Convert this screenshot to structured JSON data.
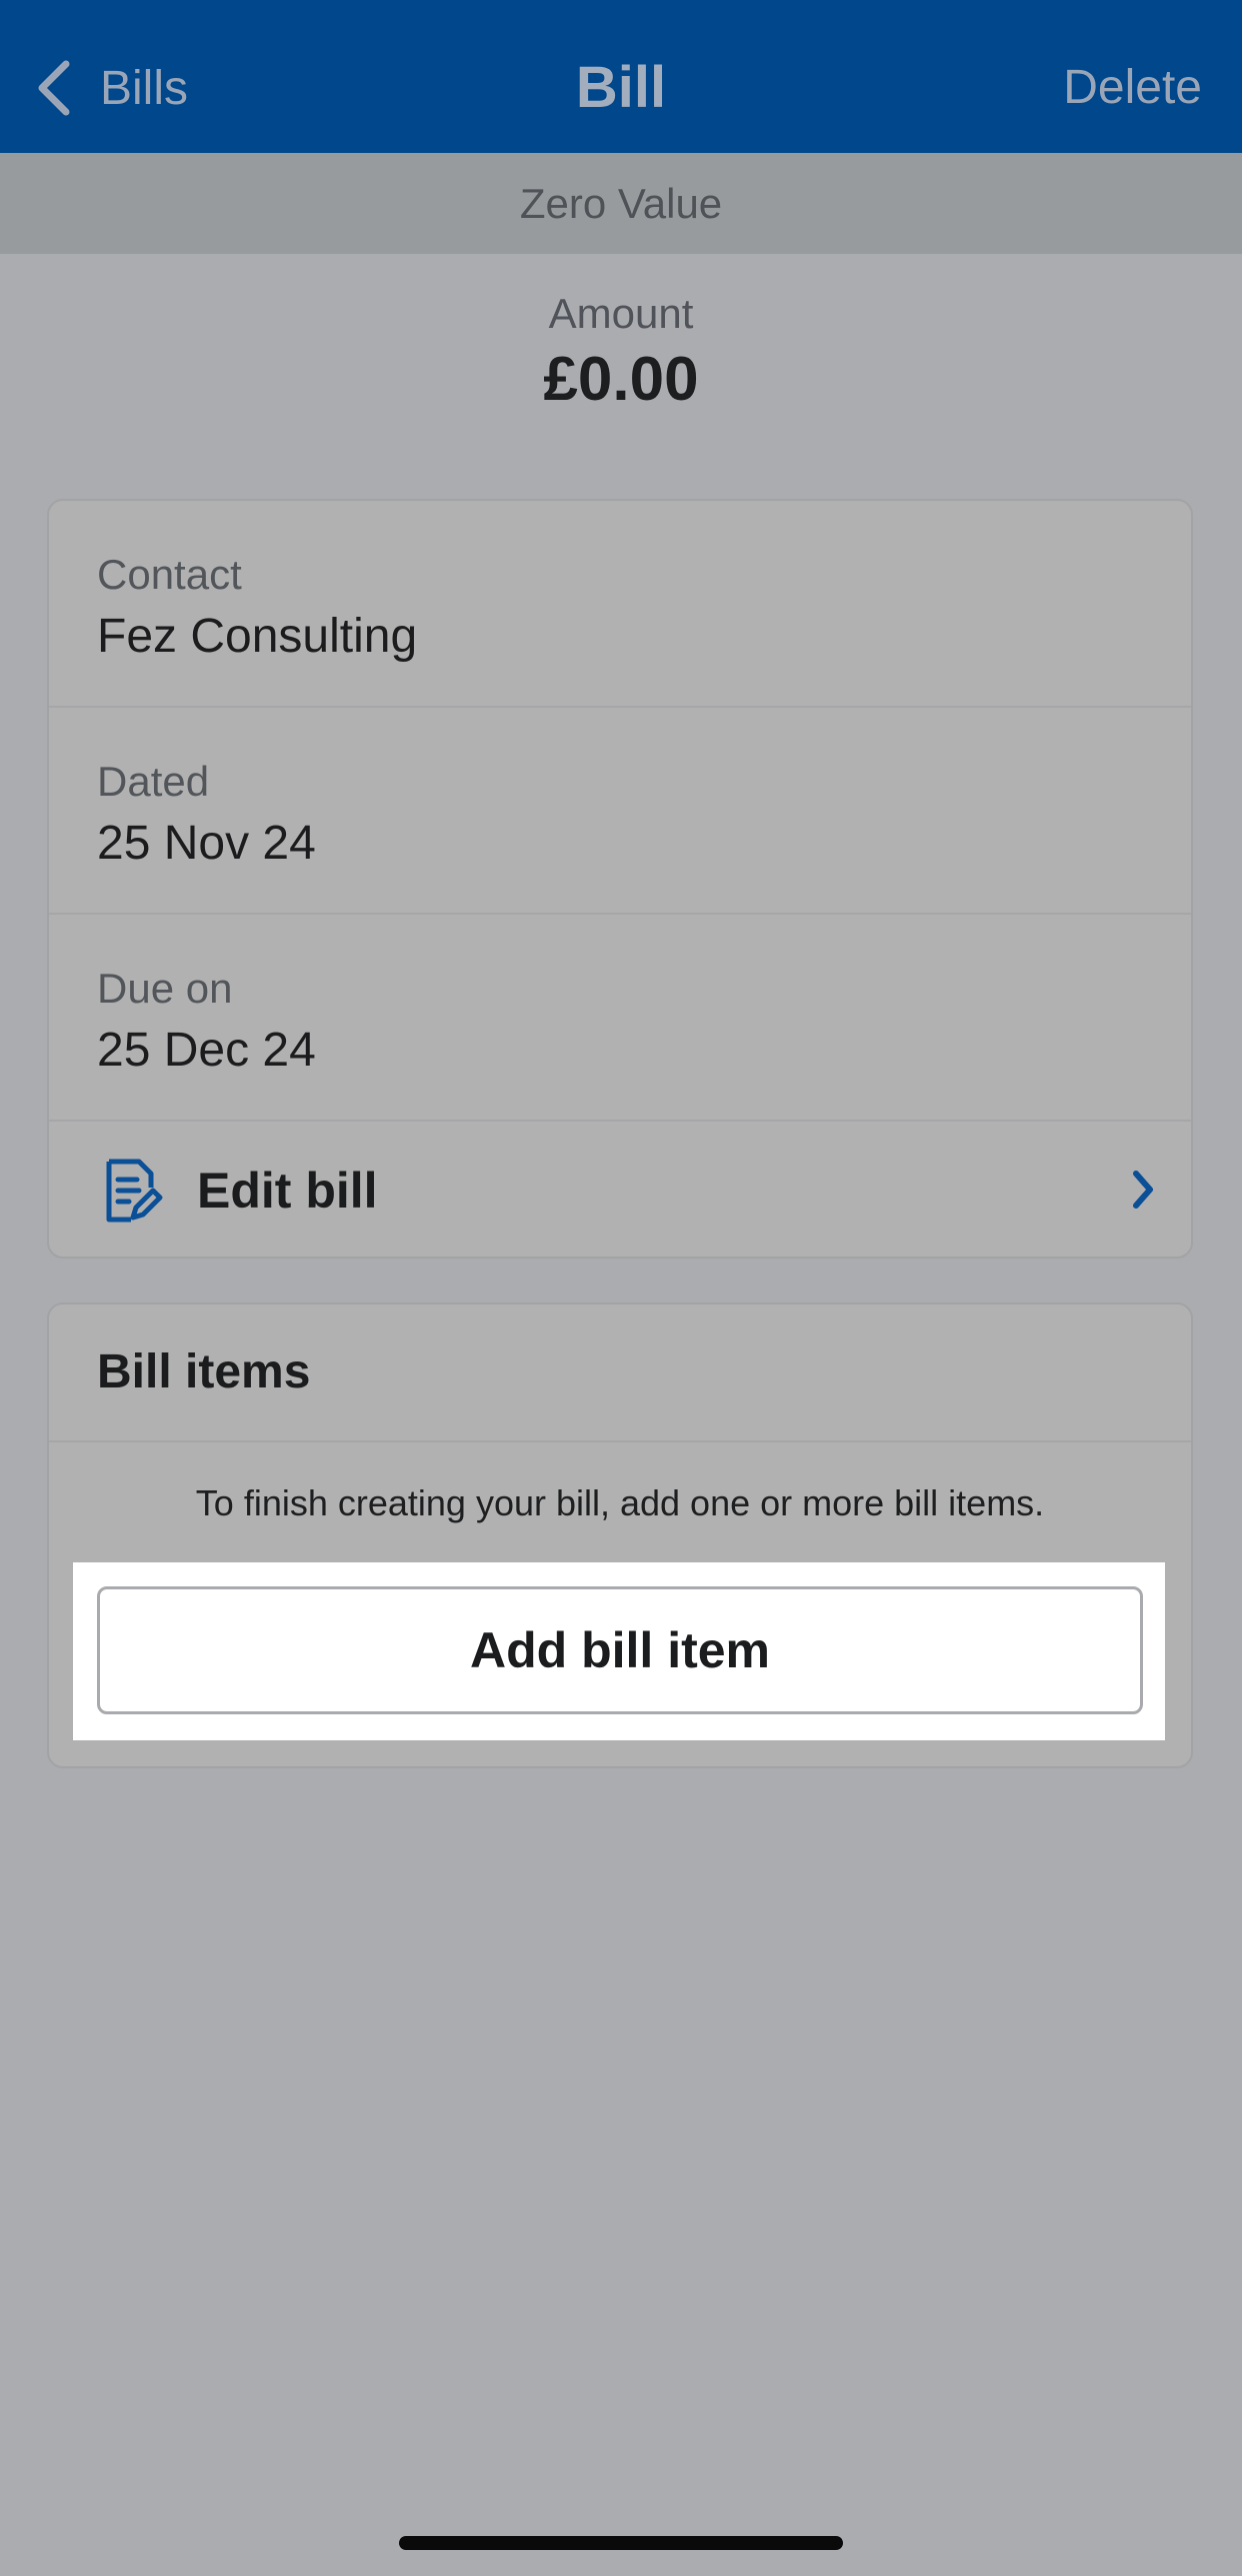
{
  "nav": {
    "back_label": "Bills",
    "title": "Bill",
    "delete_label": "Delete"
  },
  "status_banner": "Zero Value",
  "amount": {
    "label": "Amount",
    "value": "£0.00"
  },
  "details": {
    "contact": {
      "label": "Contact",
      "value": "Fez Consulting"
    },
    "dated": {
      "label": "Dated",
      "value": "25 Nov 24"
    },
    "due_on": {
      "label": "Due on",
      "value": "25 Dec 24"
    },
    "edit_label": "Edit bill"
  },
  "bill_items": {
    "title": "Bill items",
    "message": "To finish creating your bill, add one or more bill items.",
    "add_button_label": "Add bill item"
  },
  "colors": {
    "nav_background": "#00478c",
    "accent_icon": "#0b4f97",
    "page_background": "#abacb0"
  },
  "icons": {
    "back": "chevron-left-icon",
    "edit": "document-edit-icon",
    "forward": "chevron-right-icon"
  }
}
